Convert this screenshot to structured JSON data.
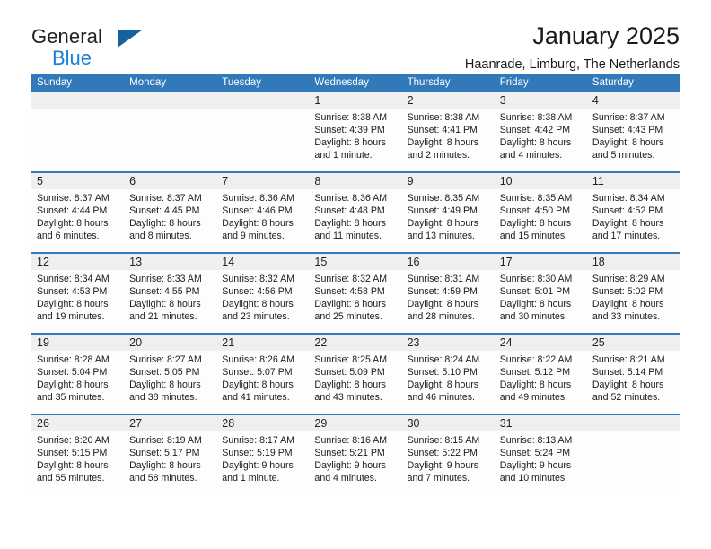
{
  "brand": {
    "name_top": "General",
    "name_bottom": "Blue",
    "accent_dark": "#15619e",
    "accent_blue": "#1a7fd4"
  },
  "header": {
    "title": "January 2025",
    "subtitle": "Haanrade, Limburg, The Netherlands"
  },
  "theme": {
    "header_blue": "#3179b9",
    "daynum_band": "#efefef",
    "cell_bg": "#fdfdfd"
  },
  "weekday_headers": [
    "Sunday",
    "Monday",
    "Tuesday",
    "Wednesday",
    "Thursday",
    "Friday",
    "Saturday"
  ],
  "weeks": [
    {
      "days": [
        {
          "num": "",
          "lines": [
            "",
            "",
            "",
            ""
          ]
        },
        {
          "num": "",
          "lines": [
            "",
            "",
            "",
            ""
          ]
        },
        {
          "num": "",
          "lines": [
            "",
            "",
            "",
            ""
          ]
        },
        {
          "num": "1",
          "lines": [
            "Sunrise: 8:38 AM",
            "Sunset: 4:39 PM",
            "Daylight: 8 hours",
            "and 1 minute."
          ]
        },
        {
          "num": "2",
          "lines": [
            "Sunrise: 8:38 AM",
            "Sunset: 4:41 PM",
            "Daylight: 8 hours",
            "and 2 minutes."
          ]
        },
        {
          "num": "3",
          "lines": [
            "Sunrise: 8:38 AM",
            "Sunset: 4:42 PM",
            "Daylight: 8 hours",
            "and 4 minutes."
          ]
        },
        {
          "num": "4",
          "lines": [
            "Sunrise: 8:37 AM",
            "Sunset: 4:43 PM",
            "Daylight: 8 hours",
            "and 5 minutes."
          ]
        }
      ]
    },
    {
      "days": [
        {
          "num": "5",
          "lines": [
            "Sunrise: 8:37 AM",
            "Sunset: 4:44 PM",
            "Daylight: 8 hours",
            "and 6 minutes."
          ]
        },
        {
          "num": "6",
          "lines": [
            "Sunrise: 8:37 AM",
            "Sunset: 4:45 PM",
            "Daylight: 8 hours",
            "and 8 minutes."
          ]
        },
        {
          "num": "7",
          "lines": [
            "Sunrise: 8:36 AM",
            "Sunset: 4:46 PM",
            "Daylight: 8 hours",
            "and 9 minutes."
          ]
        },
        {
          "num": "8",
          "lines": [
            "Sunrise: 8:36 AM",
            "Sunset: 4:48 PM",
            "Daylight: 8 hours",
            "and 11 minutes."
          ]
        },
        {
          "num": "9",
          "lines": [
            "Sunrise: 8:35 AM",
            "Sunset: 4:49 PM",
            "Daylight: 8 hours",
            "and 13 minutes."
          ]
        },
        {
          "num": "10",
          "lines": [
            "Sunrise: 8:35 AM",
            "Sunset: 4:50 PM",
            "Daylight: 8 hours",
            "and 15 minutes."
          ]
        },
        {
          "num": "11",
          "lines": [
            "Sunrise: 8:34 AM",
            "Sunset: 4:52 PM",
            "Daylight: 8 hours",
            "and 17 minutes."
          ]
        }
      ]
    },
    {
      "days": [
        {
          "num": "12",
          "lines": [
            "Sunrise: 8:34 AM",
            "Sunset: 4:53 PM",
            "Daylight: 8 hours",
            "and 19 minutes."
          ]
        },
        {
          "num": "13",
          "lines": [
            "Sunrise: 8:33 AM",
            "Sunset: 4:55 PM",
            "Daylight: 8 hours",
            "and 21 minutes."
          ]
        },
        {
          "num": "14",
          "lines": [
            "Sunrise: 8:32 AM",
            "Sunset: 4:56 PM",
            "Daylight: 8 hours",
            "and 23 minutes."
          ]
        },
        {
          "num": "15",
          "lines": [
            "Sunrise: 8:32 AM",
            "Sunset: 4:58 PM",
            "Daylight: 8 hours",
            "and 25 minutes."
          ]
        },
        {
          "num": "16",
          "lines": [
            "Sunrise: 8:31 AM",
            "Sunset: 4:59 PM",
            "Daylight: 8 hours",
            "and 28 minutes."
          ]
        },
        {
          "num": "17",
          "lines": [
            "Sunrise: 8:30 AM",
            "Sunset: 5:01 PM",
            "Daylight: 8 hours",
            "and 30 minutes."
          ]
        },
        {
          "num": "18",
          "lines": [
            "Sunrise: 8:29 AM",
            "Sunset: 5:02 PM",
            "Daylight: 8 hours",
            "and 33 minutes."
          ]
        }
      ]
    },
    {
      "days": [
        {
          "num": "19",
          "lines": [
            "Sunrise: 8:28 AM",
            "Sunset: 5:04 PM",
            "Daylight: 8 hours",
            "and 35 minutes."
          ]
        },
        {
          "num": "20",
          "lines": [
            "Sunrise: 8:27 AM",
            "Sunset: 5:05 PM",
            "Daylight: 8 hours",
            "and 38 minutes."
          ]
        },
        {
          "num": "21",
          "lines": [
            "Sunrise: 8:26 AM",
            "Sunset: 5:07 PM",
            "Daylight: 8 hours",
            "and 41 minutes."
          ]
        },
        {
          "num": "22",
          "lines": [
            "Sunrise: 8:25 AM",
            "Sunset: 5:09 PM",
            "Daylight: 8 hours",
            "and 43 minutes."
          ]
        },
        {
          "num": "23",
          "lines": [
            "Sunrise: 8:24 AM",
            "Sunset: 5:10 PM",
            "Daylight: 8 hours",
            "and 46 minutes."
          ]
        },
        {
          "num": "24",
          "lines": [
            "Sunrise: 8:22 AM",
            "Sunset: 5:12 PM",
            "Daylight: 8 hours",
            "and 49 minutes."
          ]
        },
        {
          "num": "25",
          "lines": [
            "Sunrise: 8:21 AM",
            "Sunset: 5:14 PM",
            "Daylight: 8 hours",
            "and 52 minutes."
          ]
        }
      ]
    },
    {
      "days": [
        {
          "num": "26",
          "lines": [
            "Sunrise: 8:20 AM",
            "Sunset: 5:15 PM",
            "Daylight: 8 hours",
            "and 55 minutes."
          ]
        },
        {
          "num": "27",
          "lines": [
            "Sunrise: 8:19 AM",
            "Sunset: 5:17 PM",
            "Daylight: 8 hours",
            "and 58 minutes."
          ]
        },
        {
          "num": "28",
          "lines": [
            "Sunrise: 8:17 AM",
            "Sunset: 5:19 PM",
            "Daylight: 9 hours",
            "and 1 minute."
          ]
        },
        {
          "num": "29",
          "lines": [
            "Sunrise: 8:16 AM",
            "Sunset: 5:21 PM",
            "Daylight: 9 hours",
            "and 4 minutes."
          ]
        },
        {
          "num": "30",
          "lines": [
            "Sunrise: 8:15 AM",
            "Sunset: 5:22 PM",
            "Daylight: 9 hours",
            "and 7 minutes."
          ]
        },
        {
          "num": "31",
          "lines": [
            "Sunrise: 8:13 AM",
            "Sunset: 5:24 PM",
            "Daylight: 9 hours",
            "and 10 minutes."
          ]
        },
        {
          "num": "",
          "lines": [
            "",
            "",
            "",
            ""
          ]
        }
      ]
    }
  ]
}
